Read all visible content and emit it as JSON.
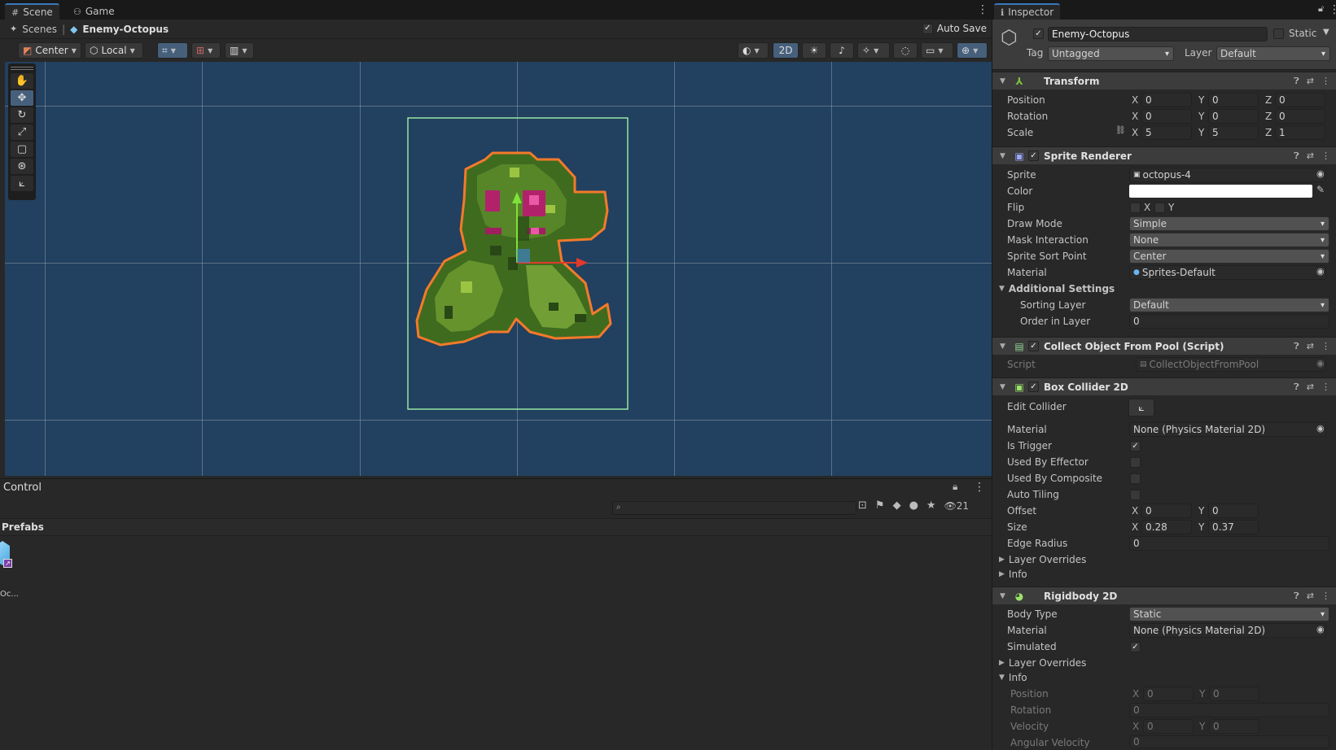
{
  "scene_panel": {
    "tabs": [
      {
        "label": "Scene"
      },
      {
        "label": "Game"
      }
    ],
    "breadcrumb": {
      "root": "Scenes",
      "current": "Enemy-Octopus"
    },
    "auto_save": {
      "label": "Auto Save",
      "checked": true
    },
    "toolbar": {
      "pivot": "Center",
      "space": "Local",
      "mode_2d": "2D"
    }
  },
  "project_panel": {
    "title": "Control",
    "search_placeholder": "",
    "hidden_count": "21",
    "folder": "Prefabs",
    "asset_label": "Oc..."
  },
  "inspector": {
    "tab": "Inspector",
    "object": {
      "name": "Enemy-Octopus",
      "active": true,
      "static_label": "Static",
      "tag_label": "Tag",
      "tag": "Untagged",
      "layer_label": "Layer",
      "layer": "Default"
    },
    "transform": {
      "title": "Transform",
      "position": {
        "label": "Position",
        "x": "0",
        "y": "0",
        "z": "0"
      },
      "rotation": {
        "label": "Rotation",
        "x": "0",
        "y": "0",
        "z": "0"
      },
      "scale": {
        "label": "Scale",
        "x": "5",
        "y": "5",
        "z": "1"
      }
    },
    "sprite_renderer": {
      "title": "Sprite Renderer",
      "sprite_label": "Sprite",
      "sprite": "octopus-4",
      "color_label": "Color",
      "flip_label": "Flip",
      "flip_x": "X",
      "flip_y": "Y",
      "draw_mode_label": "Draw Mode",
      "draw_mode": "Simple",
      "mask_label": "Mask Interaction",
      "mask": "None",
      "sort_point_label": "Sprite Sort Point",
      "sort_point": "Center",
      "material_label": "Material",
      "material": "Sprites-Default",
      "additional_label": "Additional Settings",
      "sorting_layer_label": "Sorting Layer",
      "sorting_layer": "Default",
      "order_label": "Order in Layer",
      "order": "0"
    },
    "collect_script": {
      "title": "Collect Object From Pool (Script)",
      "script_label": "Script",
      "script": "CollectObjectFromPool"
    },
    "box_collider": {
      "title": "Box Collider 2D",
      "edit_label": "Edit Collider",
      "material_label": "Material",
      "material": "None (Physics Material 2D)",
      "trigger_label": "Is Trigger",
      "is_trigger": true,
      "effector_label": "Used By Effector",
      "composite_label": "Used By Composite",
      "tiling_label": "Auto Tiling",
      "offset_label": "Offset",
      "offset_x": "0",
      "offset_y": "0",
      "size_label": "Size",
      "size_x": "0.28",
      "size_y": "0.37",
      "radius_label": "Edge Radius",
      "radius": "0",
      "overrides_label": "Layer Overrides",
      "info_label": "Info"
    },
    "rigidbody": {
      "title": "Rigidbody 2D",
      "body_type_label": "Body Type",
      "body_type": "Static",
      "material_label": "Material",
      "material": "None (Physics Material 2D)",
      "simulated_label": "Simulated",
      "simulated": true,
      "overrides_label": "Layer Overrides",
      "info_label": "Info",
      "info_position_label": "Position",
      "info_px": "0",
      "info_py": "0",
      "info_rotation_label": "Rotation",
      "info_rot": "0",
      "info_velocity_label": "Velocity",
      "info_vx": "0",
      "info_vy": "0",
      "info_angular_label": "Angular Velocity",
      "info_ang": "0"
    },
    "axis_letters": {
      "x": "X",
      "y": "Y",
      "z": "Z"
    }
  },
  "colors": {
    "viewport_bg": "#22405f",
    "accent": "#3a79bb",
    "selection": "#f47a2a",
    "collider": "#9ff2a8"
  }
}
